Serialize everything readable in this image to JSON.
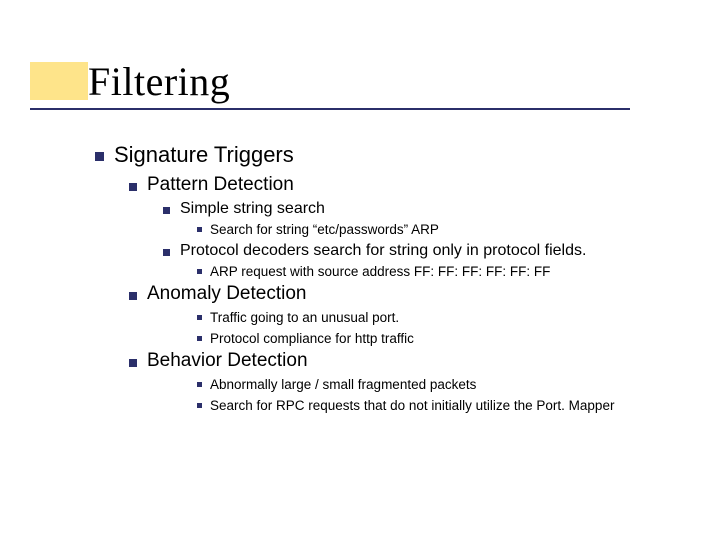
{
  "title": "Filtering",
  "outline": {
    "l0": "Signature Triggers",
    "pattern": {
      "label": "Pattern Detection",
      "simple": {
        "label": "Simple string search",
        "ex": "Search for string “etc/passwords” ARP"
      },
      "protocol": {
        "label": "Protocol decoders search for string only in protocol fields.",
        "ex": "ARP request with source address FF: FF: FF: FF: FF: FF"
      }
    },
    "anomaly": {
      "label": "Anomaly Detection",
      "a": "Traffic going to an unusual port.",
      "b": "Protocol compliance for http traffic"
    },
    "behavior": {
      "label": "Behavior Detection",
      "a": "Abnormally large / small fragmented packets",
      "b": "Search for RPC requests that do not initially utilize the Port. Mapper"
    }
  }
}
